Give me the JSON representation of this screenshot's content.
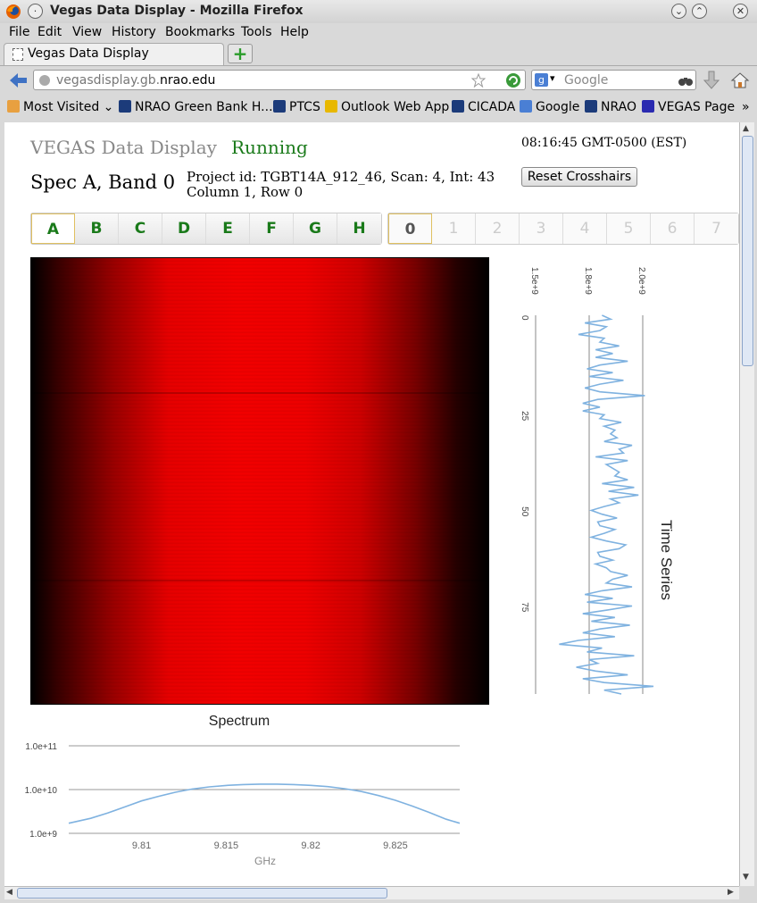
{
  "window": {
    "title": "Vegas Data Display - Mozilla Firefox",
    "menu": [
      "File",
      "Edit",
      "View",
      "History",
      "Bookmarks",
      "Tools",
      "Help"
    ],
    "tab_label": "Vegas Data Display",
    "url_host": "vegasdisplay.gb.",
    "url_domain": "nrao.edu",
    "search_placeholder": "Google",
    "bookmarks": [
      "Most Visited",
      "NRAO Green Bank H...",
      "PTCS",
      "Outlook Web App",
      "CICADA",
      "Google",
      "NRAO",
      "VEGAS Page"
    ],
    "more_bookmarks": "»"
  },
  "page": {
    "app_title": "VEGAS Data Display",
    "status": "Running",
    "clock": "08:16:45 GMT-0500 (EST)",
    "spec_band": "Spec A, Band 0",
    "project_line": "Project id: TGBT14A_912_46, Scan: 4, Int: 43",
    "position_line": "Column 1, Row 0",
    "reset_label": "Reset Crosshairs",
    "spec_tabs": [
      "A",
      "B",
      "C",
      "D",
      "E",
      "F",
      "G",
      "H"
    ],
    "selected_spec": "A",
    "band_tabs": [
      "0",
      "1",
      "2",
      "3",
      "4",
      "5",
      "6",
      "7"
    ],
    "selected_band": "0"
  },
  "colors": {
    "status_green": "#1a7a1a",
    "series_blue": "#7fb2e0",
    "heatmap_red": "#f00000"
  },
  "chart_data": [
    {
      "type": "line",
      "title": "Time Series",
      "orientation": "vertical",
      "value_axis_ticks": [
        "1.5e+9",
        "1.8e+9",
        "2.0e+9"
      ],
      "value_axis_tick_values": [
        1500000000,
        1800000000,
        2000000000
      ],
      "time_axis_ticks": [
        "0",
        "25",
        "50",
        "75"
      ],
      "time_axis_tick_values": [
        0,
        25,
        50,
        75
      ],
      "time_range": [
        0,
        99
      ],
      "value_range": [
        1500000000,
        2000000000
      ],
      "values": [
        1810000000,
        1850000000,
        1730000000,
        1830000000,
        1800000000,
        1700000000,
        1820000000,
        1800000000,
        1890000000,
        1780000000,
        1860000000,
        1780000000,
        1930000000,
        1800000000,
        1740000000,
        1860000000,
        1750000000,
        1910000000,
        1800000000,
        1730000000,
        1800000000,
        2010000000,
        1790000000,
        1720000000,
        1800000000,
        1720000000,
        1820000000,
        1800000000,
        1900000000,
        1820000000,
        1870000000,
        1850000000,
        1880000000,
        1820000000,
        1950000000,
        1890000000,
        1910000000,
        1780000000,
        1930000000,
        1830000000,
        1860000000,
        1890000000,
        1870000000,
        1930000000,
        1810000000,
        1960000000,
        1840000000,
        1980000000,
        1850000000,
        1890000000,
        1820000000,
        1760000000,
        1810000000,
        1880000000,
        1790000000,
        1800000000,
        1870000000,
        1820000000,
        1760000000,
        1830000000,
        1920000000,
        1890000000,
        1790000000,
        1800000000,
        1860000000,
        1780000000,
        1830000000,
        1850000000,
        1930000000,
        1860000000,
        1830000000,
        1950000000,
        1810000000,
        1730000000,
        1860000000,
        1740000000,
        1950000000,
        1840000000,
        1720000000,
        1870000000,
        1760000000,
        1940000000,
        1800000000,
        1720000000,
        1870000000,
        1700000000,
        1610000000,
        1810000000,
        1740000000,
        1960000000,
        1750000000,
        1790000000,
        1690000000,
        1780000000,
        1930000000,
        1720000000,
        1820000000,
        2050000000,
        1820000000,
        1900000000
      ]
    },
    {
      "type": "line",
      "title": "Spectrum",
      "xlabel": "GHz",
      "ylabel": "",
      "log_y": true,
      "x_ticks": [
        "9.81",
        "9.815",
        "9.82",
        "9.825"
      ],
      "x_tick_values": [
        9.81,
        9.815,
        9.82,
        9.825
      ],
      "y_ticks": [
        "1.0e+9",
        "1.0e+10",
        "1.0e+11"
      ],
      "y_tick_values": [
        1000000000,
        10000000000,
        100000000000
      ],
      "xlim": [
        9.8057,
        9.8288
      ],
      "ylim": [
        1000000000,
        100000000000
      ],
      "x": [
        9.8057,
        9.807,
        9.808,
        9.809,
        9.81,
        9.811,
        9.812,
        9.813,
        9.814,
        9.815,
        9.816,
        9.817,
        9.818,
        9.819,
        9.82,
        9.821,
        9.822,
        9.823,
        9.824,
        9.825,
        9.826,
        9.827,
        9.828,
        9.8288
      ],
      "values": [
        1700000000,
        2200000000,
        2900000000,
        4000000000,
        5500000000,
        7000000000,
        8700000000,
        10300000000,
        11500000000,
        12400000000,
        13000000000,
        13300000000,
        13300000000,
        13000000000,
        12500000000,
        11700000000,
        10500000000,
        9000000000,
        7300000000,
        5700000000,
        4200000000,
        3000000000,
        2100000000,
        1700000000
      ]
    }
  ]
}
